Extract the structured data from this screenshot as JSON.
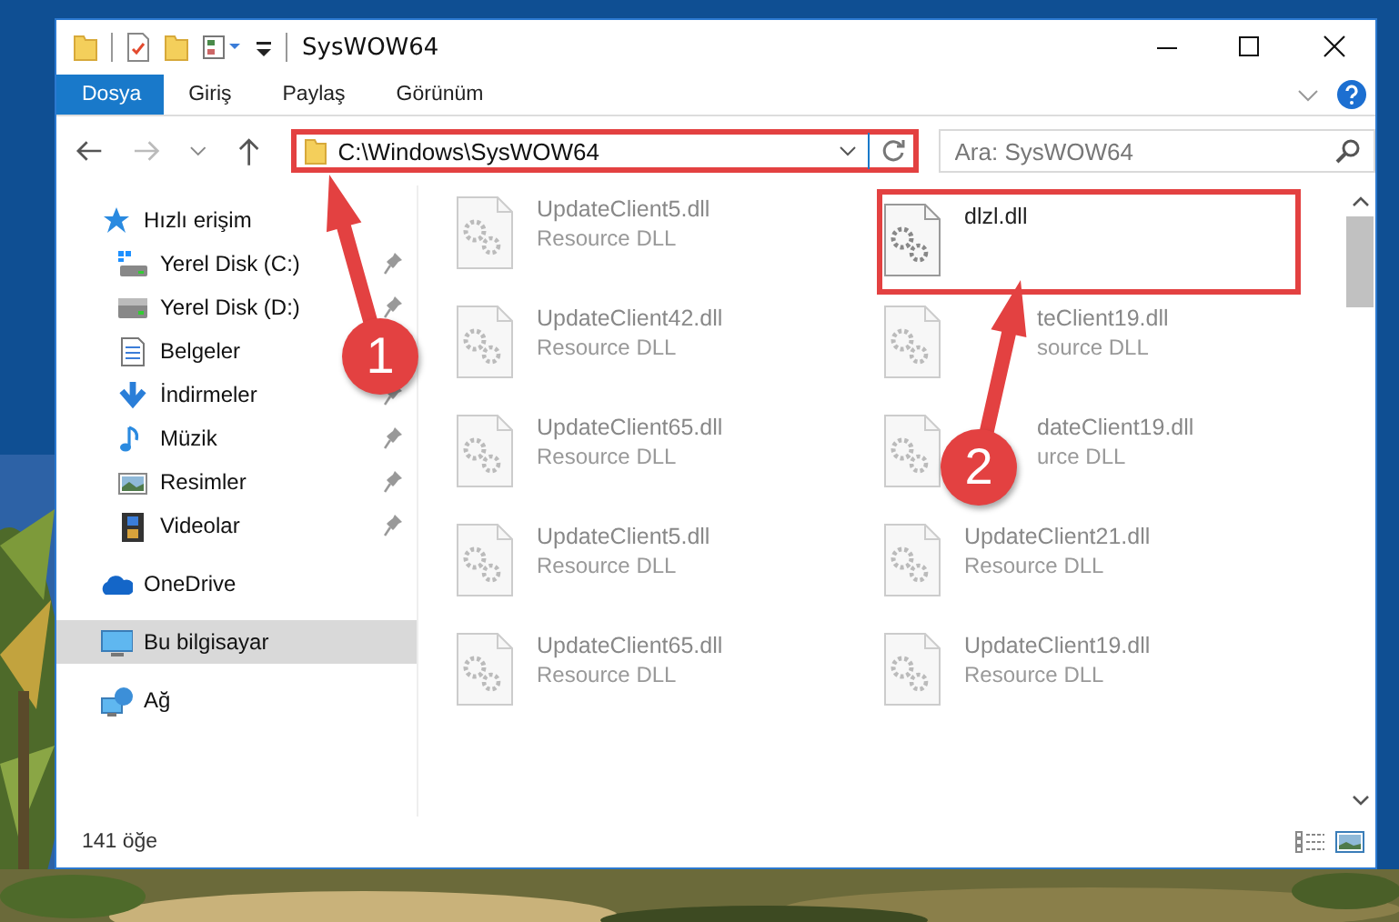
{
  "window": {
    "title": "SysWOW64"
  },
  "ribbon_tabs": [
    {
      "label": "Dosya",
      "selected": true
    },
    {
      "label": "Giriş",
      "selected": false
    },
    {
      "label": "Paylaş",
      "selected": false
    },
    {
      "label": "Görünüm",
      "selected": false
    }
  ],
  "address": {
    "path": "C:\\Windows\\SysWOW64",
    "highlighted": true
  },
  "search": {
    "placeholder": "Ara: SysWOW64"
  },
  "navigation": [
    {
      "label": "Hızlı erişim",
      "kind": "star",
      "selected": false,
      "children": [
        {
          "label": "Yerel Disk (C:)",
          "kind": "drive-c",
          "pinned": true,
          "selected": false
        },
        {
          "label": "Yerel Disk (D:)",
          "kind": "drive",
          "pinned": true,
          "selected": false
        },
        {
          "label": "Belgeler",
          "kind": "documents",
          "selected": false
        },
        {
          "label": "İndirmeler",
          "kind": "downloads",
          "pinned": true,
          "selected": false
        },
        {
          "label": "Müzik",
          "kind": "music",
          "pinned": true,
          "selected": false
        },
        {
          "label": "Resimler",
          "kind": "pictures",
          "pinned": true,
          "selected": false
        },
        {
          "label": "Videolar",
          "kind": "videos",
          "pinned": true,
          "selected": false
        }
      ]
    },
    {
      "label": "OneDrive",
      "kind": "cloud",
      "selected": false
    },
    {
      "label": "Bu bilgisayar",
      "kind": "computer",
      "selected": true
    },
    {
      "label": "Ağ",
      "kind": "network",
      "selected": false
    }
  ],
  "files": [
    {
      "name": "UpdateClient5.dll",
      "type": "Resource DLL",
      "blurred": true,
      "highlighted": false,
      "partly_covered": false
    },
    {
      "name": "dlzl.dll",
      "blurred": false,
      "highlighted": true,
      "partly_covered": false
    },
    {
      "name": "UpdateClient42.dll",
      "type": "Resource DLL",
      "blurred": true,
      "highlighted": false,
      "partly_covered": false
    },
    {
      "name": "teClient19.dll",
      "type": "source DLL",
      "blurred": true,
      "highlighted": false,
      "partly_covered": true
    },
    {
      "name": "UpdateClient65.dll",
      "type": "Resource DLL",
      "blurred": true,
      "highlighted": false,
      "partly_covered": false
    },
    {
      "name": "dateClient19.dll",
      "type": "urce DLL",
      "blurred": true,
      "highlighted": false,
      "partly_covered": true
    },
    {
      "name": "UpdateClient5.dll",
      "type": "Resource DLL",
      "blurred": true,
      "highlighted": false,
      "partly_covered": false
    },
    {
      "name": "UpdateClient21.dll",
      "type": "Resource DLL",
      "blurred": true,
      "highlighted": false,
      "partly_covered": false
    },
    {
      "name": "UpdateClient65.dll",
      "type": "Resource DLL",
      "blurred": true,
      "highlighted": false,
      "partly_covered": false
    },
    {
      "name": "UpdateClient19.dll",
      "type": "Resource DLL",
      "blurred": true,
      "highlighted": false,
      "partly_covered": false
    }
  ],
  "status_bar": {
    "count": "141 öğe"
  },
  "annotations": [
    {
      "label": "1"
    },
    {
      "label": "2"
    }
  ]
}
